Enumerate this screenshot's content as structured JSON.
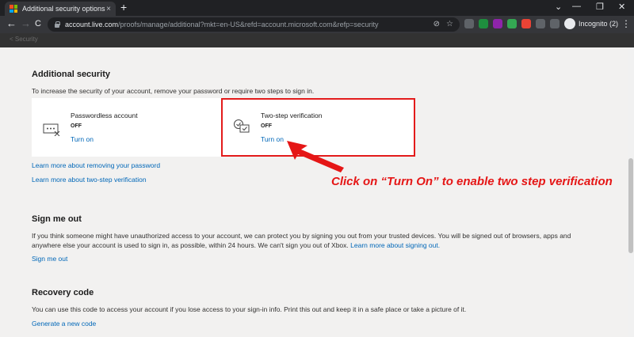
{
  "browser": {
    "tab_title": "Additional security options",
    "tab_close": "×",
    "new_tab": "+",
    "url_host": "account.live.com",
    "url_path": "/proofs/manage/additional?mkt=en-US&refd=account.microsoft.com&refp=security",
    "incognito_label": "Incognito (2)",
    "back": "←",
    "forward": "→",
    "reload": "C",
    "minimize": "—",
    "restore": "❐",
    "close": "✕",
    "menu": "⋮",
    "collapse": "⌄",
    "star": "☆",
    "icons": [
      "back-arrow-icon",
      "forward-arrow-icon",
      "reload-icon",
      "lock-icon",
      "eye-off-icon",
      "star-icon",
      "extensions-icon",
      "sidebar-icon",
      "incognito-icon",
      "menu-icon"
    ]
  },
  "page_strip_text": "< Security",
  "additional_security": {
    "heading": "Additional security",
    "description": "To increase the security of your account, remove your password or require two steps to sign in.",
    "cards": [
      {
        "title": "Passwordless account",
        "state": "OFF",
        "action": "Turn on",
        "icon": "password-dots-icon"
      },
      {
        "title": "Two-step verification",
        "state": "OFF",
        "action": "Turn on",
        "icon": "two-step-check-icon"
      }
    ],
    "link_remove_password": "Learn more about removing your password",
    "link_two_step": "Learn more about two-step verification"
  },
  "annotation": {
    "text": "Click on “Turn On” to enable two step verification",
    "color": "#e51616"
  },
  "sign_me_out": {
    "heading": "Sign me out",
    "description_line1": "If you think someone might have unauthorized access to your account, we can protect you by signing you out from your trusted devices. You will be signed out of browsers, apps and",
    "description_line2": "anywhere else your account is used to sign in, as possible, within 24 hours. We can't sign you out of Xbox.",
    "inline_link": "Learn more about signing out.",
    "action": "Sign me out"
  },
  "recovery_code": {
    "heading": "Recovery code",
    "description": "You can use this code to access your account if you lose access to your sign-in info. Print this out and keep it in a safe place or take a picture of it.",
    "action": "Generate a new code"
  },
  "colors": {
    "link": "#0067b8",
    "highlight_border": "#e31b1b",
    "page_bg": "#f2f1f0",
    "chrome_dark": "#202124"
  }
}
